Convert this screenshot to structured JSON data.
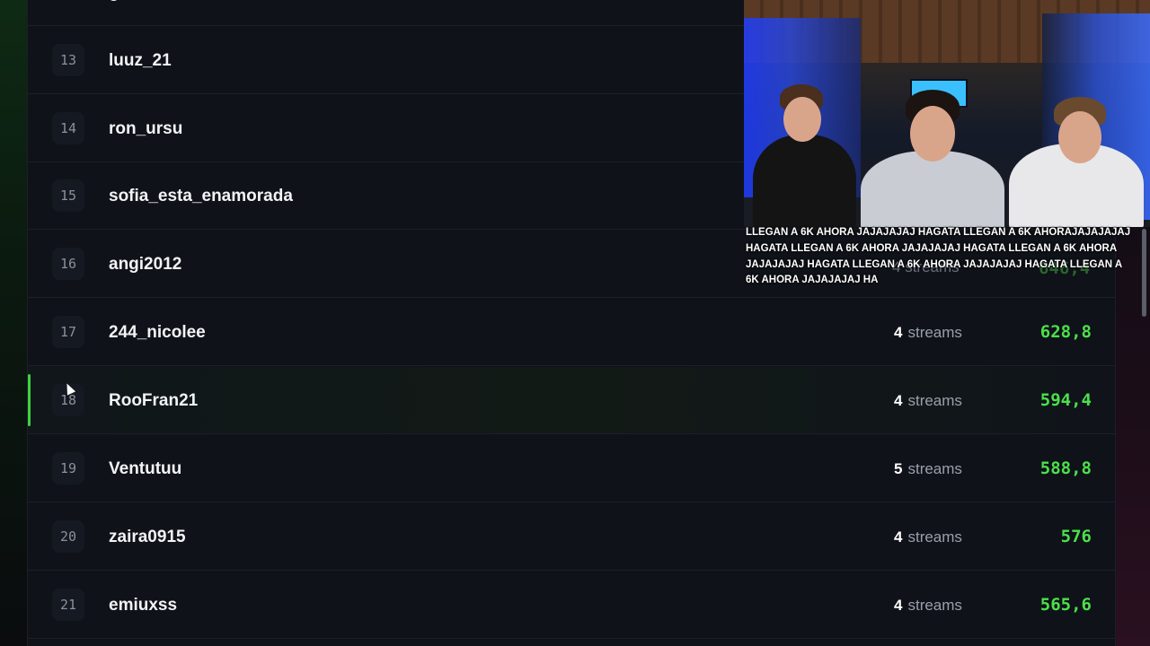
{
  "leaderboard": {
    "streams_unit": "streams",
    "partial_top_row_name": "g",
    "rows": [
      {
        "rank": "13",
        "name": "luuz_21",
        "streams": "",
        "score": ""
      },
      {
        "rank": "14",
        "name": "ron_ursu",
        "streams": "",
        "score": ""
      },
      {
        "rank": "15",
        "name": "sofia_esta_enamorada",
        "streams": "",
        "score": ""
      },
      {
        "rank": "16",
        "name": "angi2012",
        "streams": "4",
        "score": "646,4"
      },
      {
        "rank": "17",
        "name": "244_nicolee",
        "streams": "4",
        "score": "628,8"
      },
      {
        "rank": "18",
        "name": "RooFran21",
        "streams": "4",
        "score": "594,4"
      },
      {
        "rank": "19",
        "name": "Ventutuu",
        "streams": "5",
        "score": "588,8"
      },
      {
        "rank": "20",
        "name": "zaira0915",
        "streams": "4",
        "score": "576"
      },
      {
        "rank": "21",
        "name": "emiuxss",
        "streams": "4",
        "score": "565,6"
      }
    ],
    "highlighted_rank": "18",
    "accent_color": "#4be04b"
  },
  "stream_overlay": {
    "chat_message": "LLEGAN A 6K AHORA JAJAJAJAJ HAGATA LLEGAN A 6K AHORAJAJAJAJAJ HAGATA LLEGAN A 6K AHORA JAJAJAJAJ HAGATA LLEGAN A 6K AHORA JAJAJAJAJ HAGATA LLEGAN A 6K AHORA JAJAJAJAJ HAGATA LLEGAN A 6K AHORA JAJAJAJAJ HA"
  }
}
